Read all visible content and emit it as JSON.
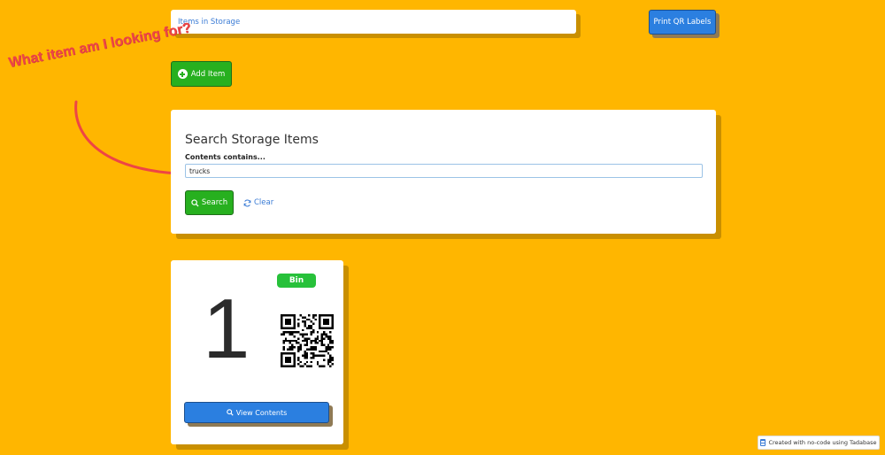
{
  "breadcrumb": {
    "label": "Items in Storage"
  },
  "toolbar": {
    "print_label": "Print QR Labels",
    "add_label": "Add Item"
  },
  "annotation": {
    "text": "What item am I looking for?"
  },
  "search": {
    "title": "Search Storage Items",
    "field_label": "Contents contains...",
    "value": "trucks",
    "search_label": "Search",
    "clear_label": "Clear"
  },
  "bin": {
    "badge": "Bin",
    "number": "1",
    "view_label": "View Contents"
  },
  "footer": {
    "text": "Created with no-code using Tadabase"
  },
  "colors": {
    "background": "#FFB600",
    "primary": "#2b7fe0",
    "success": "#27b01f",
    "annotation": "#ee4545"
  },
  "icons": [
    "plus-circle-icon",
    "search-icon",
    "refresh-icon",
    "qr-code-icon",
    "database-icon"
  ]
}
